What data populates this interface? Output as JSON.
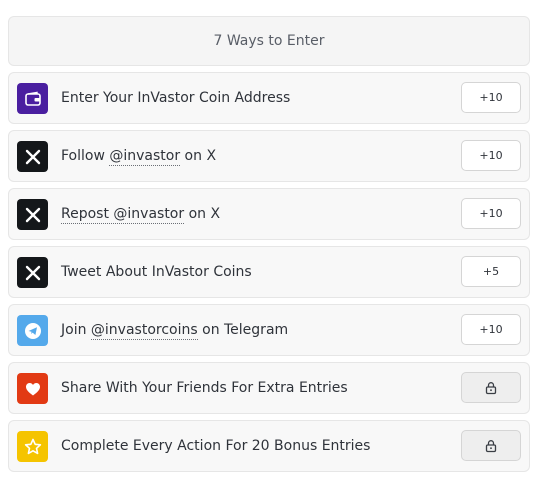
{
  "header": {
    "title": "7 Ways to Enter"
  },
  "colors": {
    "wallet": "#4a1fa0",
    "x": "#14171a",
    "telegram": "#54a9eb",
    "heart": "#e23a14",
    "star": "#f5c400"
  },
  "actions": [
    {
      "icon": "wallet-icon",
      "prefix": "Enter Your InVastor Coin Address",
      "link": "",
      "suffix": "",
      "points": "+10",
      "locked": false
    },
    {
      "icon": "x-logo-icon",
      "prefix": "Follow ",
      "link": "@invastor",
      "suffix": " on X",
      "points": "+10",
      "locked": false
    },
    {
      "icon": "x-logo-icon",
      "prefix": "",
      "link": "Repost @invastor",
      "suffix": " on X",
      "points": "+10",
      "locked": false
    },
    {
      "icon": "x-logo-icon",
      "prefix": "Tweet About InVastor Coins",
      "link": "",
      "suffix": "",
      "points": "+5",
      "locked": false
    },
    {
      "icon": "telegram-icon",
      "prefix": "Join ",
      "link": "@invastorcoins",
      "suffix": " on Telegram",
      "points": "+10",
      "locked": false
    },
    {
      "icon": "heart-icon",
      "prefix": "Share With Your Friends For Extra Entries",
      "link": "",
      "suffix": "",
      "points": "",
      "locked": true
    },
    {
      "icon": "star-icon",
      "prefix": "Complete Every Action For 20 Bonus Entries",
      "link": "",
      "suffix": "",
      "points": "",
      "locked": true
    }
  ]
}
